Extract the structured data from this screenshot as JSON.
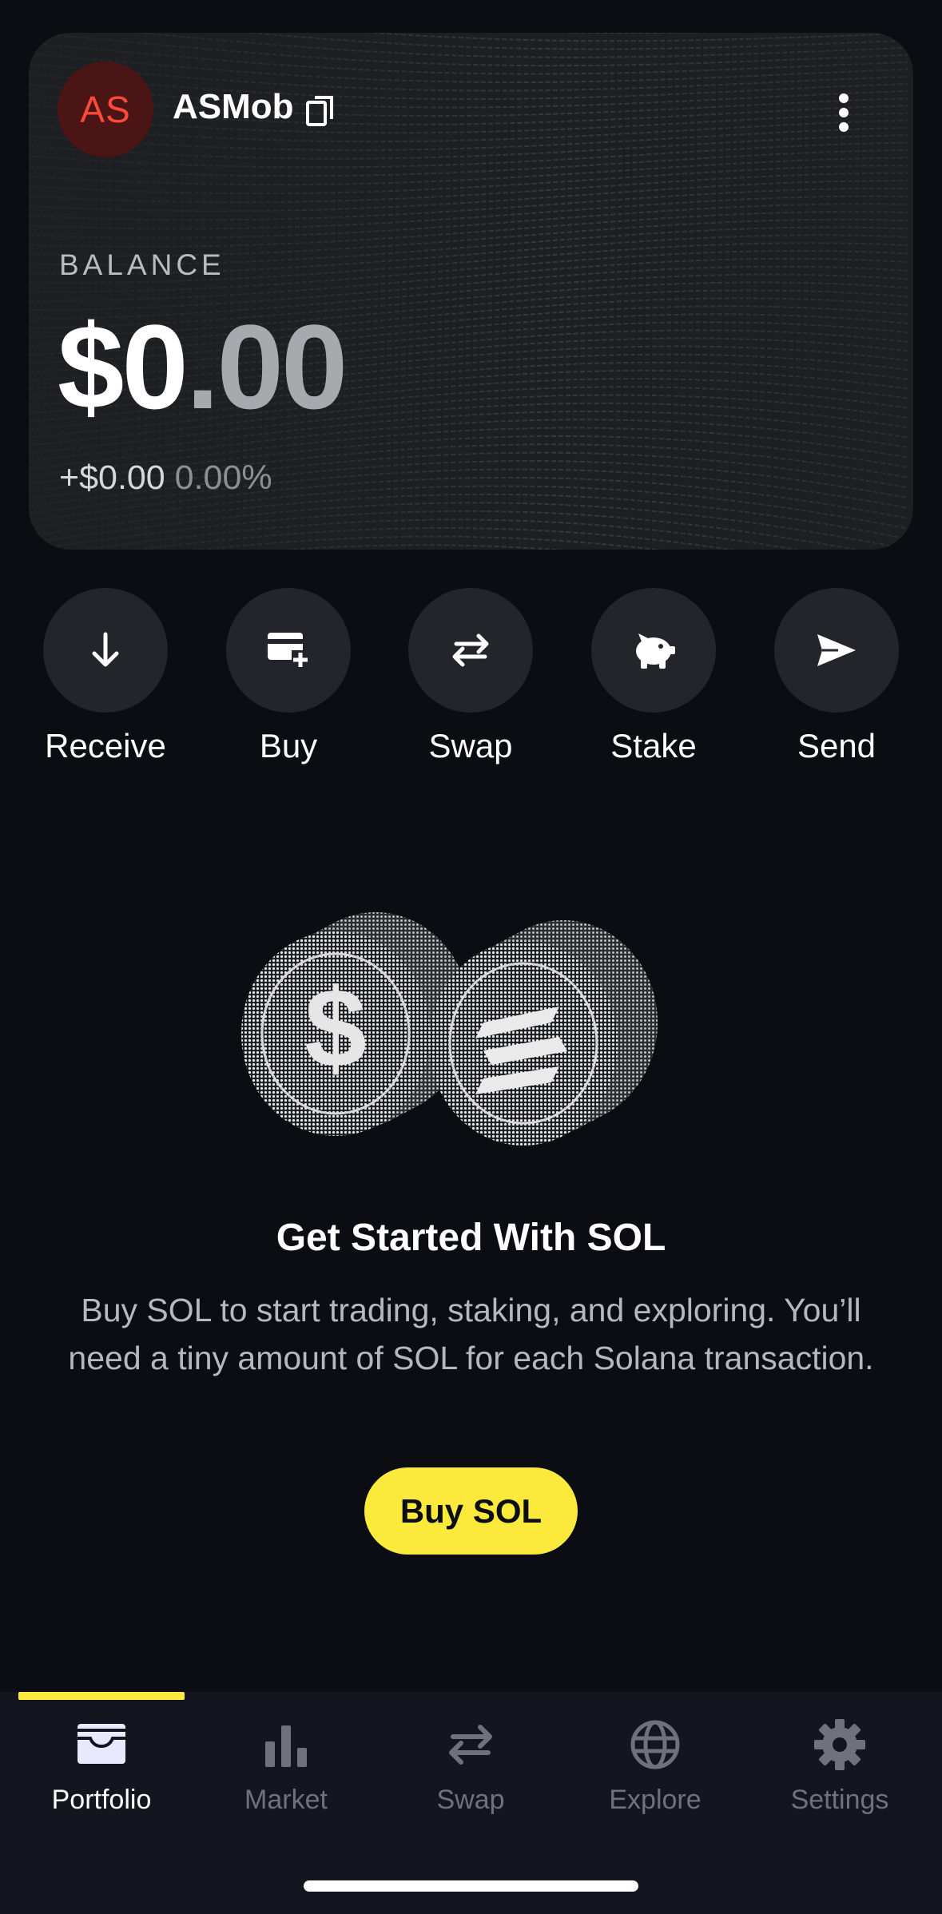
{
  "account": {
    "initials": "AS",
    "name": "ASMob",
    "copy_icon": "copy-icon",
    "menu_icon": "more-vertical-icon"
  },
  "balance": {
    "label": "BALANCE",
    "whole": "$0",
    "cents": ".00",
    "change": "+$0.00",
    "change_percent": "0.00%"
  },
  "actions": [
    {
      "label": "Receive",
      "icon": "arrow-down-icon"
    },
    {
      "label": "Buy",
      "icon": "card-plus-icon"
    },
    {
      "label": "Swap",
      "icon": "swap-arrows-icon"
    },
    {
      "label": "Stake",
      "icon": "piggy-bank-icon"
    },
    {
      "label": "Send",
      "icon": "send-icon"
    }
  ],
  "get_started": {
    "title": "Get Started With SOL",
    "description": "Buy SOL to start trading, staking, and exploring. You’ll need a tiny amount of SOL for each Solana transaction.",
    "button": "Buy SOL"
  },
  "nav": {
    "items": [
      {
        "label": "Portfolio",
        "icon": "wallet-icon",
        "active": true
      },
      {
        "label": "Market",
        "icon": "bar-chart-icon",
        "active": false
      },
      {
        "label": "Swap",
        "icon": "swap-arrows-icon",
        "active": false
      },
      {
        "label": "Explore",
        "icon": "globe-icon",
        "active": false
      },
      {
        "label": "Settings",
        "icon": "gear-icon",
        "active": false
      }
    ]
  },
  "colors": {
    "background": "#0b0d13",
    "accent": "#fbea3c",
    "avatar_bg": "#4a1514",
    "avatar_text": "#ff4a3a"
  }
}
